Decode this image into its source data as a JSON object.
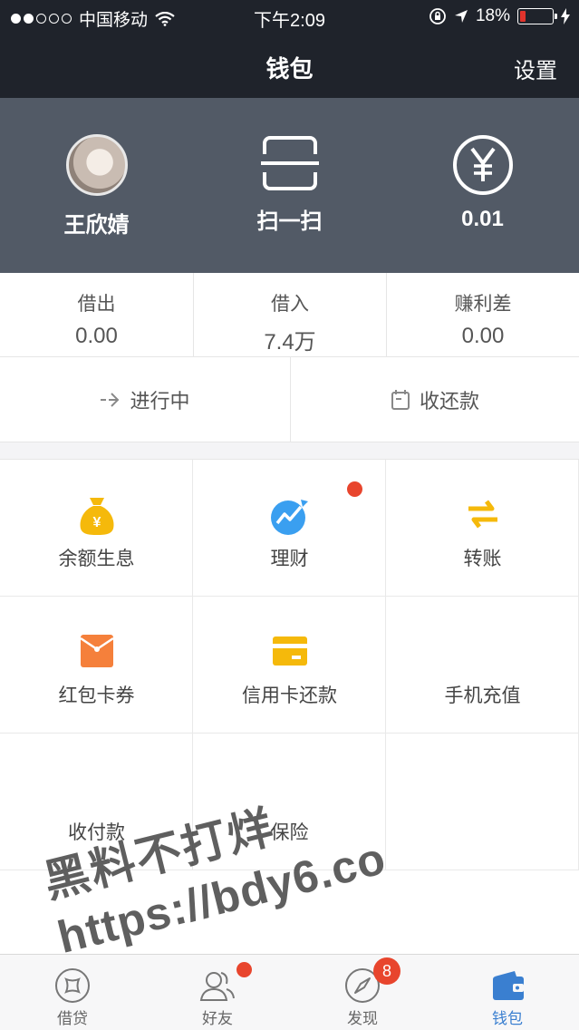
{
  "status_bar": {
    "carrier": "中国移动",
    "time": "下午2:09",
    "battery": "18%",
    "battery_level": 0.18,
    "battery_color": "#e0332c"
  },
  "nav": {
    "title": "钱包",
    "settings": "设置"
  },
  "hero": {
    "user_name": "王欣婧",
    "scan_label": "扫一扫",
    "balance": "0.01",
    "icons": [
      "avatar",
      "scan-icon",
      "yuan-icon"
    ]
  },
  "summary": [
    {
      "label": "借出",
      "value": "0.00"
    },
    {
      "label": "借入",
      "value": "7.4万"
    },
    {
      "label": "赚利差",
      "value": "0.00"
    }
  ],
  "status_row": [
    {
      "label": "进行中",
      "icon": "arrow-right-icon"
    },
    {
      "label": "收还款",
      "icon": "calendar-icon"
    }
  ],
  "services": [
    {
      "label": "余额生息",
      "icon": "money-bag-icon",
      "color": "#f5b90b"
    },
    {
      "label": "理财",
      "icon": "chart-trend-icon",
      "color": "#3a9ff0",
      "has_dot": true
    },
    {
      "label": "转账",
      "icon": "transfer-icon",
      "color": "#f5b90b"
    },
    {
      "label": "红包卡券",
      "icon": "red-envelope-icon",
      "color": "#f5803b"
    },
    {
      "label": "信用卡还款",
      "icon": "credit-card-icon",
      "color": "#f5b90b"
    },
    {
      "label": "手机充值",
      "icon": ""
    },
    {
      "label": "收付款",
      "icon": ""
    },
    {
      "label": "保险",
      "icon": ""
    },
    {
      "label": "",
      "icon": ""
    }
  ],
  "watermark": {
    "line1": "黑料不打烊",
    "line2": "https://bdy6.co"
  },
  "tabbar": [
    {
      "label": "借贷",
      "icon": "loan-icon"
    },
    {
      "label": "好友",
      "icon": "friends-icon",
      "has_dot": true
    },
    {
      "label": "发现",
      "icon": "compass-icon",
      "badge": "8"
    },
    {
      "label": "钱包",
      "icon": "wallet-icon",
      "active": true
    }
  ],
  "colors": {
    "header_bg": "#1f232b",
    "hero_bg": "#525a66",
    "accent_blue": "#3a7fd0",
    "badge_red": "#e8452d"
  }
}
